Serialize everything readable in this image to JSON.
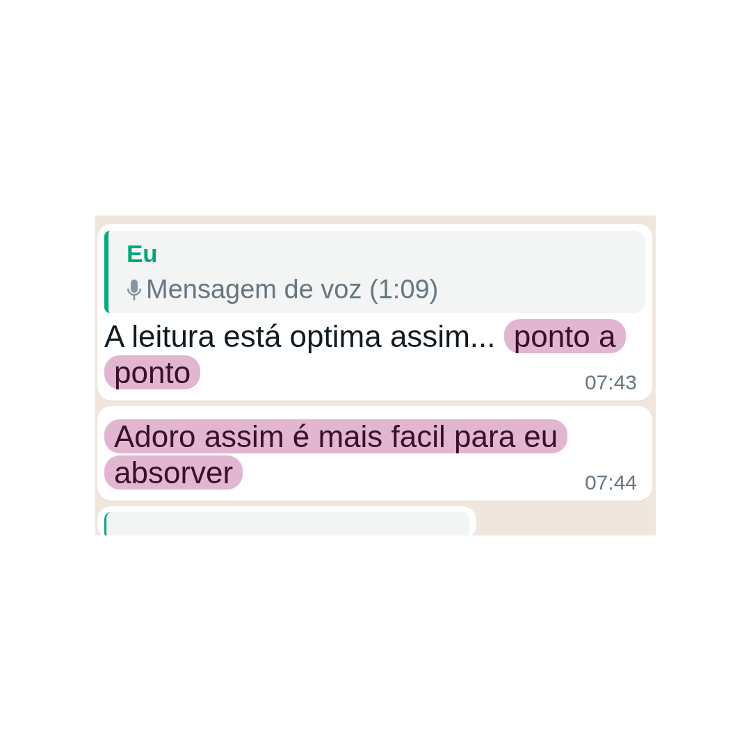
{
  "messages": [
    {
      "kind": "message",
      "quote": {
        "sender": "Eu",
        "kind": "voice",
        "text": "Mensagem de voz (1:09)"
      },
      "segments": [
        {
          "text": "A leitura está optima assim...",
          "highlighted": false
        },
        {
          "text": "ponto a ponto",
          "highlighted": true
        }
      ],
      "time": "07:43"
    },
    {
      "kind": "message",
      "segments": [
        {
          "text": "Adoro assim é mais facil para eu absorver",
          "highlighted": true
        }
      ],
      "time": "07:44"
    },
    {
      "kind": "partial"
    }
  ]
}
